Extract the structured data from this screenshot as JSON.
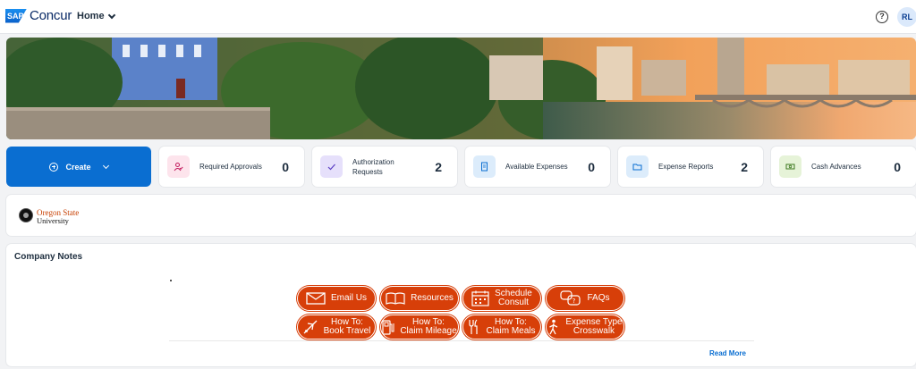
{
  "header": {
    "brand_sap": "SAP",
    "brand_name": "Concur",
    "home_label": "Home",
    "help_symbol": "?",
    "avatar_initials": "RL"
  },
  "create_tile": {
    "label": "Create"
  },
  "tiles": [
    {
      "label": "Required Approvals",
      "count": "0",
      "icon": "person-check-icon",
      "color": "#fde4ec"
    },
    {
      "label": "Authorization Requests",
      "label_line1": "Authorization",
      "label_line2": "Requests",
      "count": "2",
      "icon": "check-icon",
      "color": "#e6e0fb"
    },
    {
      "label": "Available Expenses",
      "count": "0",
      "icon": "receipt-icon",
      "color": "#dcecfb"
    },
    {
      "label": "Expense Reports",
      "count": "2",
      "icon": "folder-icon",
      "color": "#dcecfb"
    },
    {
      "label": "Cash Advances",
      "count": "0",
      "icon": "cash-icon",
      "color": "#e6f3d8"
    }
  ],
  "org": {
    "name_line1": "Oregon State",
    "name_line2": "University"
  },
  "company_notes": {
    "title": "Company Notes",
    "read_more": "Read More",
    "buttons": [
      {
        "line1": "Email Us",
        "line2": "",
        "icon": "envelope-icon"
      },
      {
        "line1": "Resources",
        "line2": "",
        "icon": "book-icon"
      },
      {
        "line1": "Schedule",
        "line2": "Consult",
        "icon": "calendar-icon"
      },
      {
        "line1": "FAQs",
        "line2": "",
        "icon": "chat-bubbles-icon"
      },
      {
        "line1": "How To:",
        "line2": "Book Travel",
        "icon": "airplane-icon"
      },
      {
        "line1": "How To:",
        "line2": "Claim Mileage",
        "icon": "fuel-pump-icon"
      },
      {
        "line1": "How To:",
        "line2": "Claim Meals",
        "icon": "utensils-icon"
      },
      {
        "line1": "Expense Type",
        "line2": "Crosswalk",
        "icon": "pedestrian-icon"
      }
    ]
  },
  "colors": {
    "primary": "#0a6ed1",
    "osu_orange": "#d73f09"
  }
}
